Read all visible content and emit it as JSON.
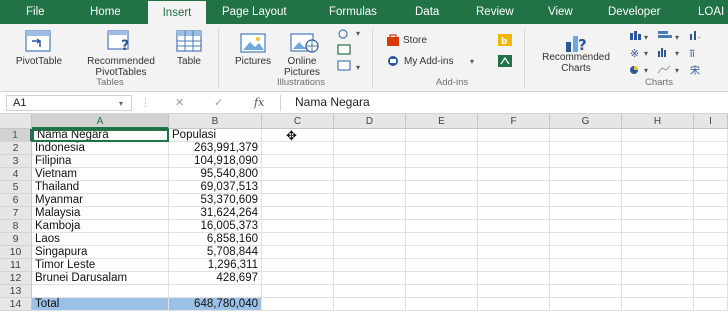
{
  "menu": {
    "tabs": [
      {
        "label": "File"
      },
      {
        "label": "Home"
      },
      {
        "label": "Insert"
      },
      {
        "label": "Page Layout"
      },
      {
        "label": "Formulas"
      },
      {
        "label": "Data"
      },
      {
        "label": "Review"
      },
      {
        "label": "View"
      },
      {
        "label": "Developer"
      },
      {
        "label": "LOAI"
      }
    ]
  },
  "ribbon": {
    "tables": {
      "pivot_line1": "PivotTable",
      "rec_line1": "Recommended",
      "rec_line2": "PivotTables",
      "table": "Table",
      "group": "Tables"
    },
    "illustrations": {
      "pictures": "Pictures",
      "online_line1": "Online",
      "online_line2": "Pictures",
      "group": "Illustrations"
    },
    "addins": {
      "store": "Store",
      "my_addins": "My Add-ins",
      "group": "Add-ins"
    },
    "charts": {
      "rec_line1": "Recommended",
      "rec_line2": "Charts",
      "group": "Charts"
    }
  },
  "formula_bar": {
    "name_box": "A1",
    "fx": "fx",
    "content": "Nama Negara"
  },
  "sheet": {
    "columns": [
      "A",
      "B",
      "C",
      "D",
      "E",
      "F",
      "G",
      "H",
      "I"
    ],
    "rows": [
      {
        "num": "1",
        "a": "Nama Negara",
        "b": "Populasi"
      },
      {
        "num": "2",
        "a": "Indonesia",
        "b": "263,991,379"
      },
      {
        "num": "3",
        "a": "Filipina",
        "b": "104,918,090"
      },
      {
        "num": "4",
        "a": "Vietnam",
        "b": "95,540,800"
      },
      {
        "num": "5",
        "a": "Thailand",
        "b": "69,037,513"
      },
      {
        "num": "6",
        "a": "Myanmar",
        "b": "53,370,609"
      },
      {
        "num": "7",
        "a": "Malaysia",
        "b": "31,624,264"
      },
      {
        "num": "8",
        "a": "Kamboja",
        "b": "16,005,373"
      },
      {
        "num": "9",
        "a": "Laos",
        "b": "6,858,160"
      },
      {
        "num": "10",
        "a": "Singapura",
        "b": "5,708,844"
      },
      {
        "num": "11",
        "a": "Timor Leste",
        "b": "1,296,311"
      },
      {
        "num": "12",
        "a": "Brunei Darusalam",
        "b": "428,697"
      },
      {
        "num": "13",
        "a": "",
        "b": ""
      },
      {
        "num": "14",
        "a": "Total",
        "b": "648,780,040"
      }
    ]
  },
  "colors": {
    "accent": "#217346",
    "total_fill": "#9bc2e6"
  }
}
